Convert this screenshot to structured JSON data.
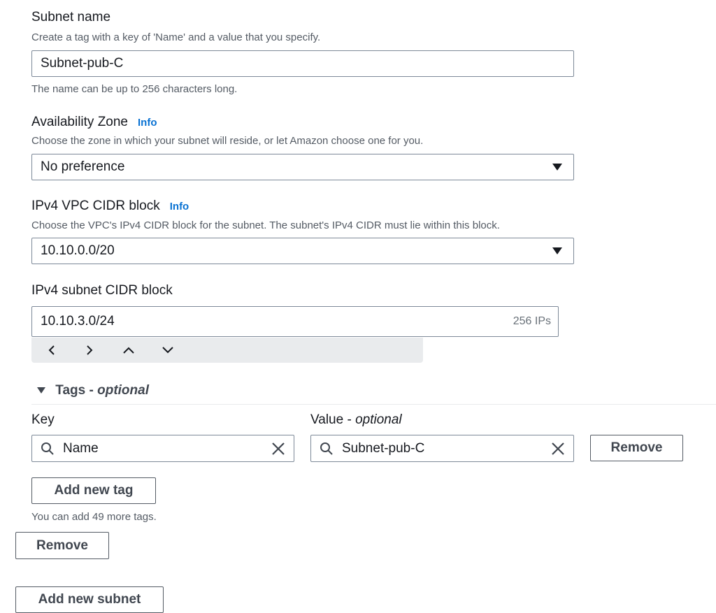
{
  "subnet_name": {
    "label": "Subnet name",
    "description": "Create a tag with a key of 'Name' and a value that you specify.",
    "value": "Subnet-pub-C",
    "constraint": "The name can be up to 256 characters long."
  },
  "availability_zone": {
    "label": "Availability Zone",
    "info": "Info",
    "description": "Choose the zone in which your subnet will reside, or let Amazon choose one for you.",
    "value": "No preference"
  },
  "ipv4_vpc_cidr": {
    "label": "IPv4 VPC CIDR block",
    "info": "Info",
    "description": "Choose the VPC's IPv4 CIDR block for the subnet. The subnet's IPv4 CIDR must lie within this block.",
    "value": "10.10.0.0/20"
  },
  "ipv4_subnet_cidr": {
    "label": "IPv4 subnet CIDR block",
    "value": "10.10.3.0/24",
    "suffix": "256 IPs"
  },
  "tags": {
    "header_prefix": "Tags - ",
    "header_optional": "optional",
    "key_label": "Key",
    "value_label_prefix": "Value - ",
    "value_label_optional": "optional",
    "rows": [
      {
        "key": "Name",
        "value": "Subnet-pub-C",
        "remove_label": "Remove"
      }
    ],
    "add_tag_label": "Add new tag",
    "remaining_text": "You can add 49 more tags."
  },
  "remove_subnet_label": "Remove",
  "add_subnet_label": "Add new subnet",
  "colors": {
    "link": "#0972d3",
    "border": "#7d8998",
    "text": "#16191f",
    "muted": "#545b64"
  }
}
